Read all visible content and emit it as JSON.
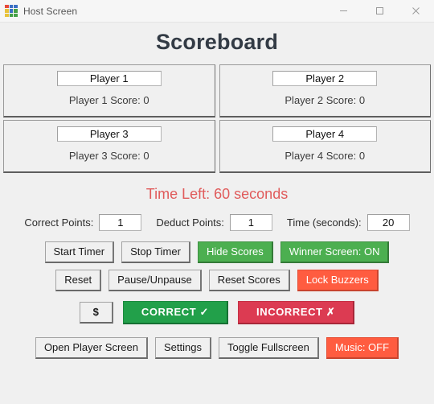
{
  "window": {
    "title": "Host Screen",
    "icon": "app-grid-icon",
    "controls": {
      "minimize": "minimize-icon",
      "maximize": "maximize-icon",
      "close": "close-icon"
    }
  },
  "header": {
    "title": "Scoreboard"
  },
  "players": [
    {
      "name_value": "Player 1",
      "name_placeholder": "Player 1",
      "score_label": "Player 1 Score: 0"
    },
    {
      "name_value": "Player 2",
      "name_placeholder": "Player 2",
      "score_label": "Player 2 Score: 0"
    },
    {
      "name_value": "Player 3",
      "name_placeholder": "Player 3",
      "score_label": "Player 3 Score: 0"
    },
    {
      "name_value": "Player 4",
      "name_placeholder": "Player 4",
      "score_label": "Player 4 Score: 0"
    }
  ],
  "timer": {
    "text": "Time Left: 60 seconds",
    "color": "#e05b5b"
  },
  "settings": {
    "correct_points_label": "Correct Points:",
    "correct_points_value": "1",
    "deduct_points_label": "Deduct Points:",
    "deduct_points_value": "1",
    "time_seconds_label": "Time (seconds):",
    "time_seconds_value": "20"
  },
  "controls": {
    "start_timer": "Start Timer",
    "stop_timer": "Stop Timer",
    "hide_scores": "Hide Scores",
    "winner_screen": "Winner Screen: ON",
    "reset": "Reset",
    "pause_unpause": "Pause/Unpause",
    "reset_scores": "Reset Scores",
    "lock_buzzers": "Lock Buzzers",
    "money": "$",
    "correct": "CORRECT ✓",
    "incorrect": "INCORRECT ✗",
    "open_player_screen": "Open Player Screen",
    "settings": "Settings",
    "toggle_fullscreen": "Toggle Fullscreen",
    "music": "Music: OFF"
  },
  "colors": {
    "background": "#f0f0f0",
    "accent_green": "#4caf50",
    "accent_green_strong": "#22a04a",
    "accent_red_strong": "#dc3b52",
    "accent_orange": "#ff5c40",
    "timer_red": "#e05b5b",
    "title_text": "#333b45"
  }
}
